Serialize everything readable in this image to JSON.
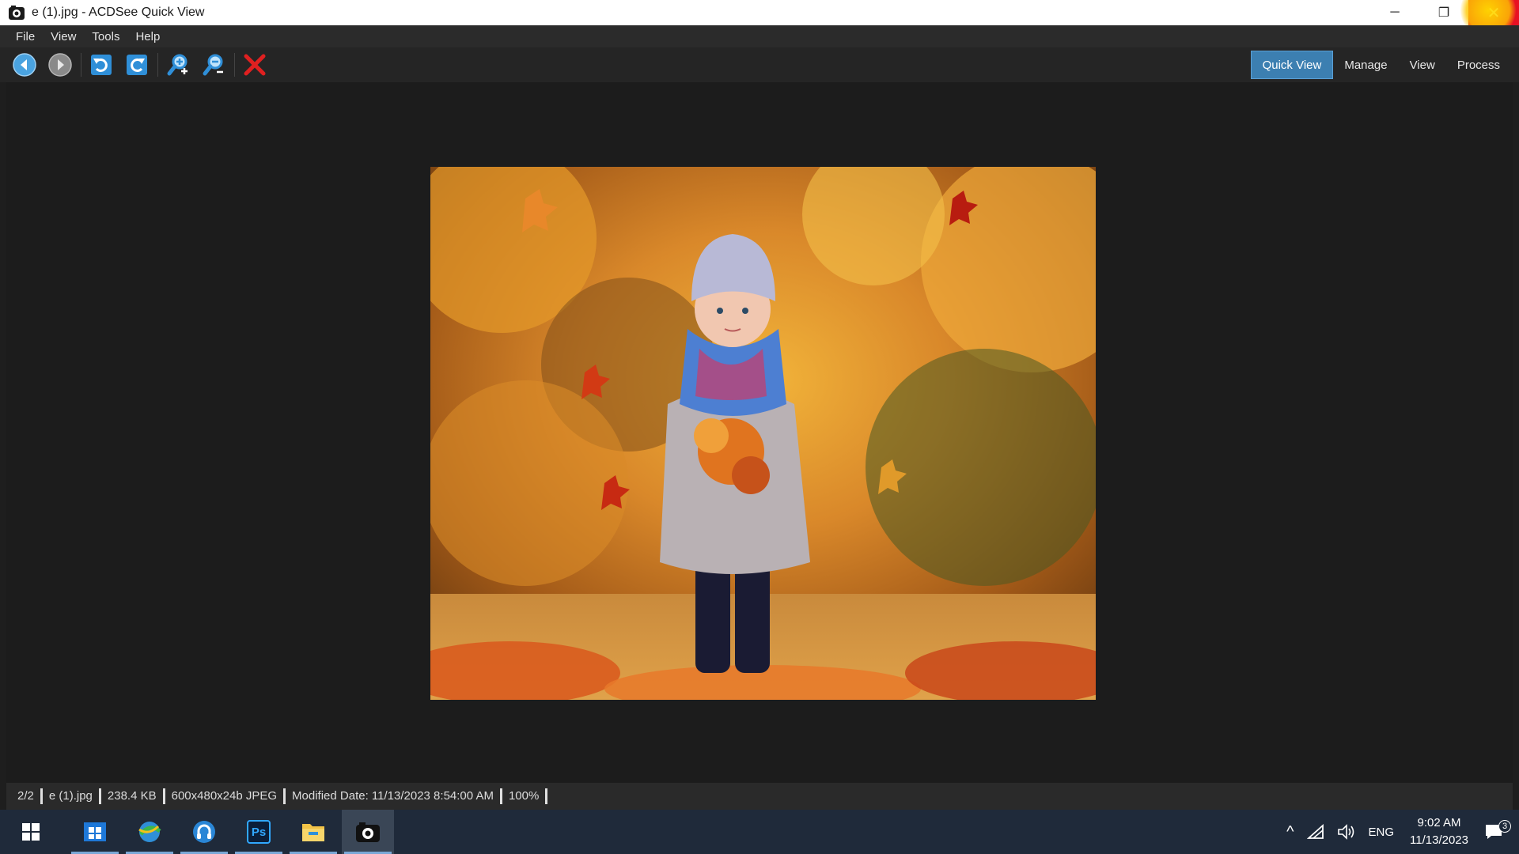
{
  "window": {
    "title": "e (1).jpg - ACDSee Quick View",
    "minimize": "─",
    "restore": "❐",
    "close": "✕"
  },
  "menu": [
    {
      "label": "File"
    },
    {
      "label": "View"
    },
    {
      "label": "Tools"
    },
    {
      "label": "Help"
    }
  ],
  "toolbar": {
    "buttons": [
      {
        "name": "previous-image-button",
        "icon": "arrow-left-icon"
      },
      {
        "name": "next-image-button",
        "icon": "arrow-right-icon"
      },
      {
        "name": "rotate-left-button",
        "icon": "rotate-left-icon"
      },
      {
        "name": "rotate-right-button",
        "icon": "rotate-right-icon"
      },
      {
        "name": "zoom-in-button",
        "icon": "zoom-in-icon"
      },
      {
        "name": "zoom-out-button",
        "icon": "zoom-out-icon"
      },
      {
        "name": "delete-button",
        "icon": "delete-x-icon"
      }
    ],
    "modes": [
      {
        "label": "Quick View",
        "active": true
      },
      {
        "label": "Manage",
        "active": false
      },
      {
        "label": "View",
        "active": false
      },
      {
        "label": "Process",
        "active": false
      }
    ]
  },
  "status": {
    "position": "2/2",
    "filename": "e (1).jpg",
    "filesize": "238.4 KB",
    "dimensions": "600x480x24b JPEG",
    "modified": "Modified Date: 11/13/2023 8:54:00 AM",
    "zoom": "100%"
  },
  "taskbar": {
    "apps": [
      {
        "name": "start-button",
        "icon": "windows-logo-icon"
      },
      {
        "name": "taskbar-app-store",
        "icon": "store-icon"
      },
      {
        "name": "taskbar-app-browser",
        "icon": "browser-icon"
      },
      {
        "name": "taskbar-app-headphones",
        "icon": "headphones-icon"
      },
      {
        "name": "taskbar-app-photoshop",
        "icon": "photoshop-icon",
        "label": "Ps"
      },
      {
        "name": "taskbar-app-file-explorer",
        "icon": "folder-icon"
      },
      {
        "name": "taskbar-app-acdsee",
        "icon": "acdsee-icon"
      }
    ],
    "tray": {
      "chevron": "^",
      "language": "ENG",
      "time": "9:02 AM",
      "date": "11/13/2023",
      "notifications": "3"
    }
  },
  "colors": {
    "accent": "#3c7fb1",
    "close_red": "#e81123",
    "delete_red": "#e02020",
    "taskbar": "#1f2a3a"
  }
}
